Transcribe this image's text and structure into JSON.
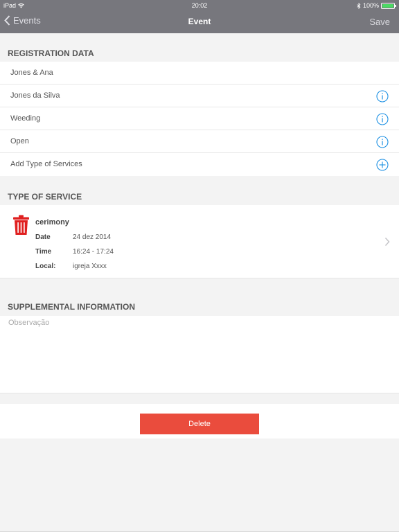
{
  "status_bar": {
    "device": "iPad",
    "time": "20:02",
    "battery": "100%",
    "battery_color": "#4cd964"
  },
  "nav": {
    "back_label": "Events",
    "title": "Event",
    "save_label": "Save"
  },
  "registration": {
    "header": "REGISTRATION DATA",
    "rows": [
      {
        "label": "Jones & Ana",
        "icon": ""
      },
      {
        "label": "Jones da Silva",
        "icon": "info-icon"
      },
      {
        "label": "Weeding",
        "icon": "info-icon"
      },
      {
        "label": "Open",
        "icon": "info-icon"
      },
      {
        "label": "Add Type of Services",
        "icon": "plus-circle-icon"
      }
    ]
  },
  "service": {
    "header": "TYPE OF SERVICE",
    "name": "cerimony",
    "date_label": "Date",
    "date_value": "24 dez 2014",
    "time_label": "Time",
    "time_value": "16:24 - 17:24",
    "local_label": "Local:",
    "local_value": "igreja Xxxx",
    "icon": "trash-icon",
    "accent": "#e02020"
  },
  "supplemental": {
    "header": "SUPPLEMENTAL INFORMATION",
    "placeholder": "Observação",
    "value": ""
  },
  "delete": {
    "label": "Delete",
    "color": "#ea4c3d"
  },
  "colors": {
    "nav_bg": "#77777d",
    "info_blue": "#1a8fe3"
  }
}
